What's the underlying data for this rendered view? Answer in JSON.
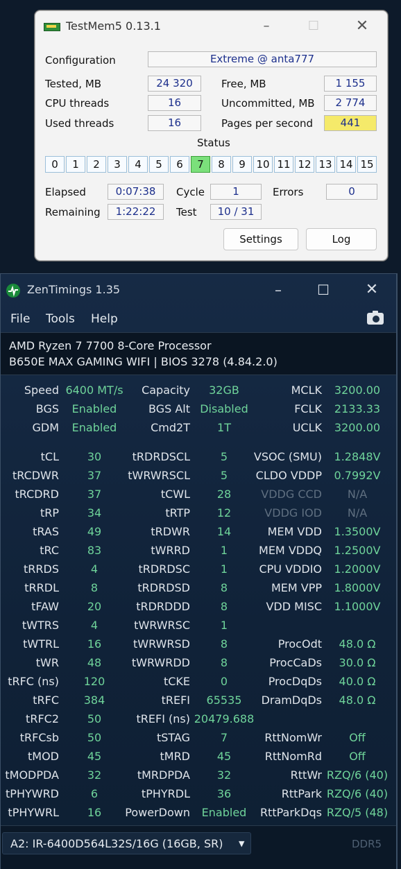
{
  "testmem": {
    "title": "TestMem5  0.13.1",
    "configuration_label": "Configuration",
    "configuration_value": "Extreme @ anta777",
    "tested_label": "Tested, MB",
    "tested_value": "24 320",
    "free_label": "Free, MB",
    "free_value": "1 155",
    "cpu_threads_label": "CPU threads",
    "cpu_threads_value": "16",
    "uncommitted_label": "Uncommitted, MB",
    "uncommitted_value": "2 774",
    "used_threads_label": "Used threads",
    "used_threads_value": "16",
    "pages_label": "Pages per second",
    "pages_value": "441",
    "status_label": "Status",
    "threads": [
      "0",
      "1",
      "2",
      "3",
      "4",
      "5",
      "6",
      "7",
      "8",
      "9",
      "10",
      "11",
      "12",
      "13",
      "14",
      "15"
    ],
    "active_thread": "7",
    "elapsed_label": "Elapsed",
    "elapsed_value": "0:07:38",
    "cycle_label": "Cycle",
    "cycle_value": "1",
    "errors_label": "Errors",
    "errors_value": "0",
    "remaining_label": "Remaining",
    "remaining_value": "1:22:22",
    "test_label": "Test",
    "test_value": "10 / 31",
    "settings_button": "Settings",
    "log_button": "Log"
  },
  "zen": {
    "title": "ZenTimings 1.35",
    "menu": [
      "File",
      "Tools",
      "Help"
    ],
    "cpu": "AMD Ryzen 7 7700 8-Core Processor",
    "board": "B650E MAX GAMING WIFI | BIOS 3278 (4.84.2.0)",
    "top_rows": [
      [
        "Speed",
        "6400 MT/s",
        "Capacity",
        "32GB",
        "MCLK",
        "3200.00"
      ],
      [
        "BGS",
        "Enabled",
        "BGS Alt",
        "Disabled",
        "FCLK",
        "2133.33"
      ],
      [
        "GDM",
        "Enabled",
        "Cmd2T",
        "1T",
        "UCLK",
        "3200.00"
      ]
    ],
    "timing_rows": [
      [
        "tCL",
        "30",
        "tRDRDSCL",
        "5",
        "VSOC (SMU)",
        "1.2848V"
      ],
      [
        "tRCDWR",
        "37",
        "tWRWRSCL",
        "5",
        "CLDO VDDP",
        "0.7992V"
      ],
      [
        "tRCDRD",
        "37",
        "tCWL",
        "28",
        "VDDG CCD",
        "N/A"
      ],
      [
        "tRP",
        "34",
        "tRTP",
        "12",
        "VDDG IOD",
        "N/A"
      ],
      [
        "tRAS",
        "49",
        "tRDWR",
        "14",
        "MEM VDD",
        "1.3500V"
      ],
      [
        "tRC",
        "83",
        "tWRRD",
        "1",
        "MEM VDDQ",
        "1.2500V"
      ],
      [
        "tRRDS",
        "4",
        "tRDRDSC",
        "1",
        "CPU VDDIO",
        "1.2000V"
      ],
      [
        "tRRDL",
        "8",
        "tRDRDSD",
        "8",
        "MEM VPP",
        "1.8000V"
      ],
      [
        "tFAW",
        "20",
        "tRDRDDD",
        "8",
        "VDD MISC",
        "1.1000V"
      ],
      [
        "tWTRS",
        "4",
        "tWRWRSC",
        "1",
        "",
        ""
      ],
      [
        "tWTRL",
        "16",
        "tWRWRSD",
        "8",
        "ProcOdt",
        "48.0 Ω"
      ],
      [
        "tWR",
        "48",
        "tWRWRDD",
        "8",
        "ProcCaDs",
        "30.0 Ω"
      ],
      [
        "tRFC (ns)",
        "120",
        "tCKE",
        "0",
        "ProcDqDs",
        "40.0 Ω"
      ],
      [
        "tRFC",
        "384",
        "tREFI",
        "65535",
        "DramDqDs",
        "48.0 Ω"
      ],
      [
        "tRFC2",
        "50",
        "tREFI (ns)",
        "20479.688",
        "",
        ""
      ],
      [
        "tRFCsb",
        "50",
        "tSTAG",
        "7",
        "RttNomWr",
        "Off"
      ],
      [
        "tMOD",
        "45",
        "tMRD",
        "45",
        "RttNomRd",
        "Off"
      ],
      [
        "tMODPDA",
        "32",
        "tMRDPDA",
        "32",
        "RttWr",
        "RZQ/6 (40)"
      ],
      [
        "tPHYWRD",
        "6",
        "tPHYRDL",
        "36",
        "RttPark",
        "RZQ/6 (40)"
      ],
      [
        "tPHYWRL",
        "16",
        "PowerDown",
        "Enabled",
        "RttParkDqs",
        "RZQ/5 (48)"
      ]
    ],
    "dimm_select": "A2: IR-6400D564L32S/16G (16GB, SR)",
    "memory_type": "DDR5",
    "colors": {
      "value_green": "#6fd49a",
      "dim": "#5f6f80",
      "highlight_yellow": "#f5ea6a",
      "active_thread": "#7be07b"
    }
  }
}
